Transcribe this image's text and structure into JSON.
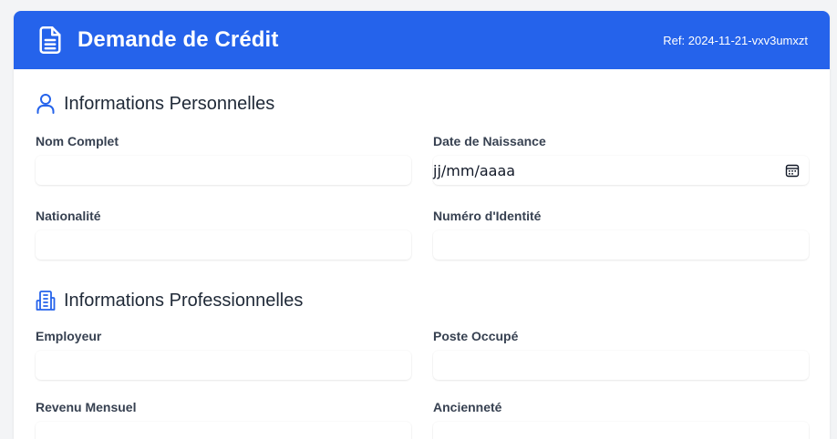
{
  "header": {
    "title": "Demande de Crédit",
    "ref": "Ref: 2024-11-21-vxv3umxzt",
    "icon": "document-icon"
  },
  "personal": {
    "title": "Informations Personnelles",
    "icon": "user-icon",
    "fields": {
      "full_name": {
        "label": "Nom Complet",
        "value": ""
      },
      "birth_date": {
        "label": "Date de Naissance",
        "placeholder": "jj/mm/aaaa"
      },
      "nationality": {
        "label": "Nationalité",
        "value": ""
      },
      "id_number": {
        "label": "Numéro d'Identité",
        "value": ""
      }
    }
  },
  "professional": {
    "title": "Informations Professionnelles",
    "icon": "building-icon",
    "fields": {
      "employer": {
        "label": "Employeur",
        "value": ""
      },
      "position": {
        "label": "Poste Occupé",
        "value": ""
      },
      "monthly_income": {
        "label": "Revenu Mensuel",
        "value": ""
      },
      "seniority": {
        "label": "Ancienneté",
        "value": ""
      }
    }
  },
  "colors": {
    "accent": "#2563eb",
    "background": "#f3f4f6",
    "card": "#ffffff"
  }
}
